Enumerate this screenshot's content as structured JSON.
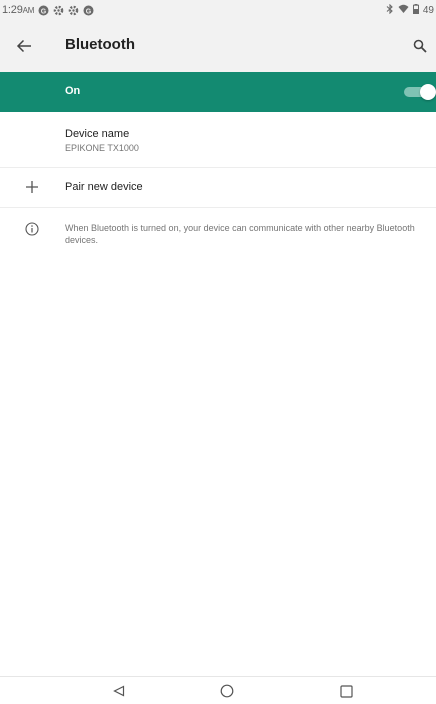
{
  "status_bar": {
    "time": "1:29",
    "am_pm": "AM",
    "battery_text": "49",
    "icons": [
      "notification-g-icon",
      "settings-gear-icon",
      "settings-gear-icon",
      "notification-g-icon",
      "bluetooth-icon",
      "wifi-icon",
      "battery-icon"
    ]
  },
  "toolbar": {
    "title": "Bluetooth",
    "back_icon": "arrow-back-icon",
    "search_icon": "search-icon"
  },
  "master_switch": {
    "label": "On",
    "state": "on",
    "accent_color": "#138a71"
  },
  "device_name": {
    "title": "Device name",
    "value": "EPIKONE TX1000"
  },
  "pair_new_device": {
    "label": "Pair new device",
    "icon": "plus-icon"
  },
  "info": {
    "icon": "info-icon",
    "text": "When Bluetooth is turned on, your device can communicate with other nearby Bluetooth devices."
  },
  "nav_bar": {
    "icons": [
      "nav-back-icon",
      "nav-home-icon",
      "nav-recents-icon"
    ]
  }
}
